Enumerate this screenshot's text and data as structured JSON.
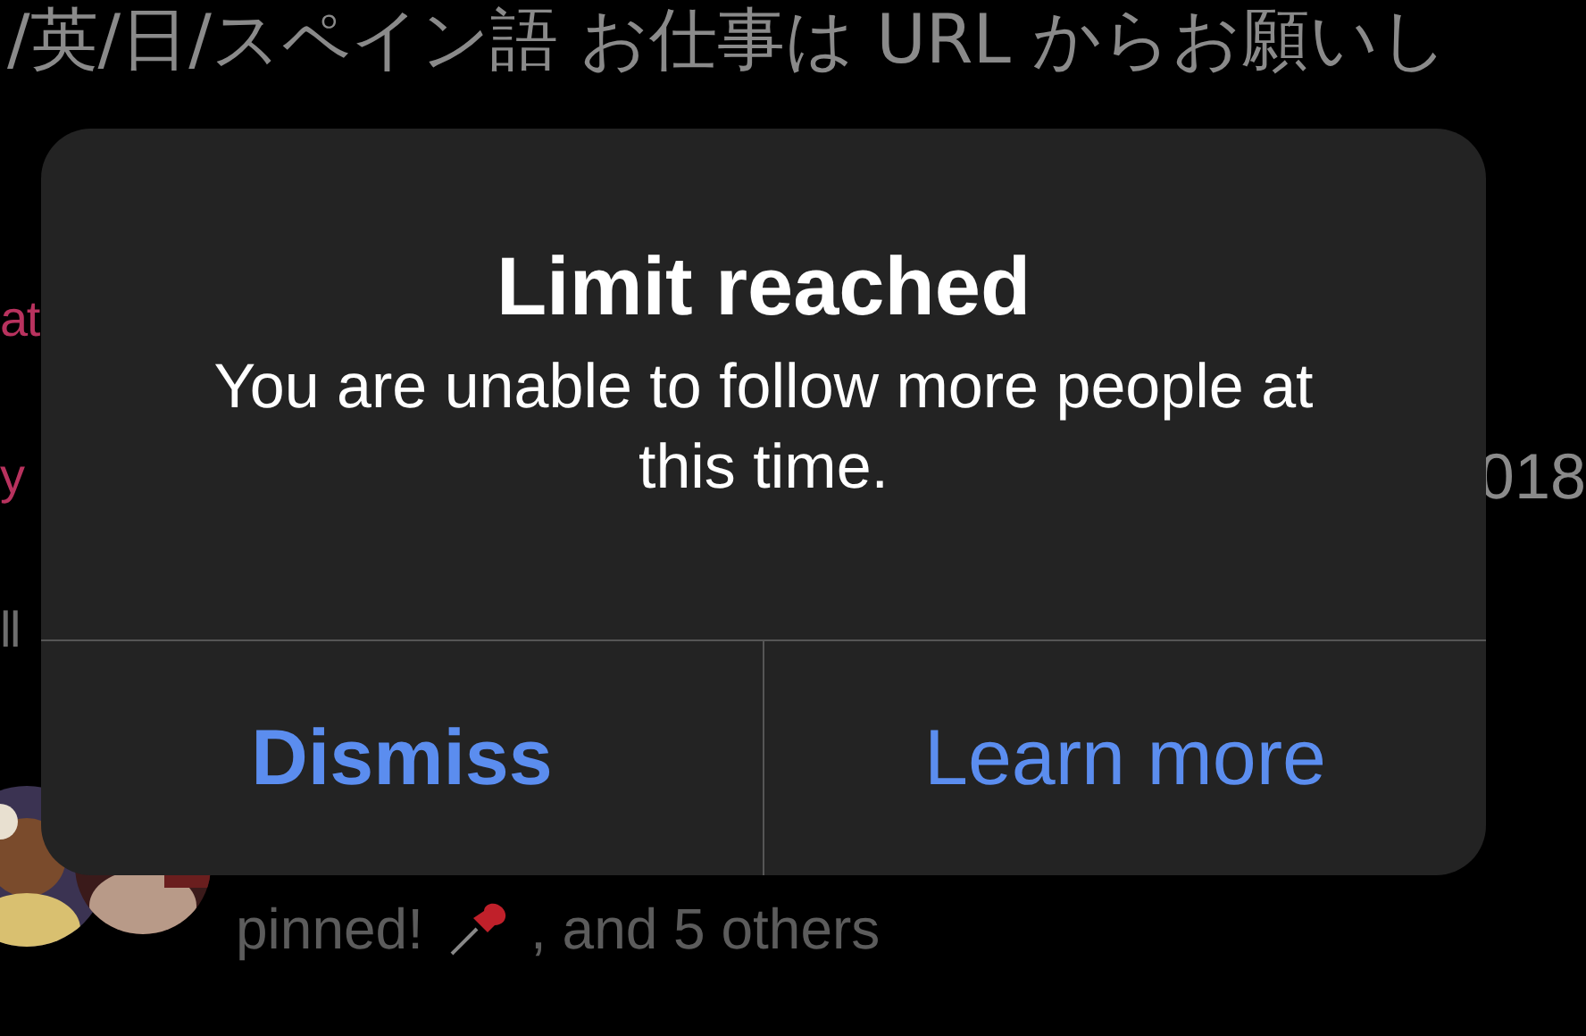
{
  "background": {
    "bio_text": "/英/日/スペイン語 お仕事は URL からお願いし",
    "fragments": [
      {
        "text": "at",
        "kind": "link"
      },
      {
        "text": "y",
        "kind": "link"
      },
      {
        "text": "ll",
        "kind": "muted"
      }
    ],
    "date_fragment": "018",
    "followers_text": {
      "before": "pinned!",
      "after": ", and 5 others"
    }
  },
  "alert": {
    "title": "Limit reached",
    "message": "You are unable to follow more people at this time.",
    "buttons": [
      {
        "label": "Dismiss",
        "kind": "primary"
      },
      {
        "label": "Learn more",
        "kind": "default"
      }
    ]
  }
}
